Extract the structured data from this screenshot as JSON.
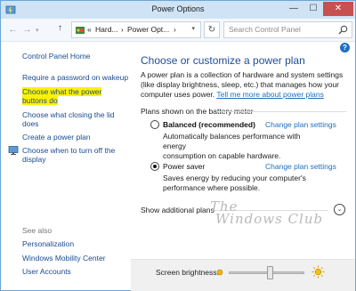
{
  "window": {
    "title": "Power Options",
    "controls": {
      "minimize": "—",
      "maximize": "☐",
      "close": "✕"
    }
  },
  "address": {
    "back_icon": "←",
    "forward_icon": "→",
    "up_icon": "↑",
    "crumbs": [
      "«",
      "Hard...",
      "›",
      "Power Opt...",
      "›"
    ],
    "dropdown_icon": "▾",
    "refresh_icon": "↻",
    "search_placeholder": "Search Control Panel"
  },
  "sidebar": {
    "home": "Control Panel Home",
    "links": [
      {
        "line1": "Require a password on wakeup",
        "line2": ""
      },
      {
        "line1": "Choose what the power",
        "line2": "buttons do",
        "highlighted": true
      },
      {
        "line1": "Choose what closing the lid",
        "line2": "does"
      },
      {
        "line1": "Create a power plan",
        "line2": ""
      },
      {
        "line1": "Choose when to turn off the",
        "line2": "display"
      }
    ],
    "see_also_label": "See also",
    "see_also": [
      "Personalization",
      "Windows Mobility Center",
      "User Accounts"
    ]
  },
  "main": {
    "help_icon": "?",
    "title": "Choose or customize a power plan",
    "description_lines": [
      "A power plan is a collection of hardware and system settings",
      "(like display brightness, sleep, etc.) that manages how your",
      "computer uses power."
    ],
    "description_link": "Tell me more about power plans",
    "section_header": "Plans shown on the battery meter",
    "plans": [
      {
        "name": "Balanced (recommended)",
        "bold": true,
        "selected": false,
        "desc_lines": [
          "Automatically balances performance with energy",
          "consumption on capable hardware."
        ],
        "change_link": "Change plan settings"
      },
      {
        "name": "Power saver",
        "bold": false,
        "selected": true,
        "desc_lines": [
          "Saves energy by reducing your computer's",
          "performance where possible."
        ],
        "change_link": "Change plan settings"
      }
    ],
    "show_additional": "Show additional plans",
    "expand_icon": "⌄",
    "watermark_line1": "The",
    "watermark_line2": "Windows Club"
  },
  "brightness": {
    "label": "Screen brightness:",
    "level": 0.55
  },
  "colors": {
    "link": "#1e6fc2",
    "title": "#1e4e98",
    "highlight": "#fff200",
    "titlebar": "#cfe3f4",
    "close": "#c75050"
  }
}
